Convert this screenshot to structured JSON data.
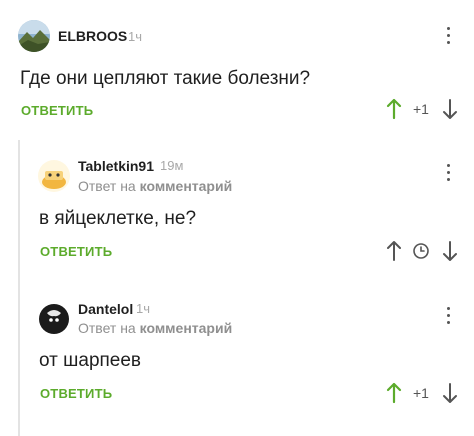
{
  "comments": [
    {
      "username": "ELBROOS",
      "time": "1ч",
      "text": "Где они цепляют такие болезни?",
      "reply_label": "ОТВЕТИТЬ",
      "rating": "+1",
      "avatar_icon": "mountain-landscape-avatar"
    },
    {
      "username": "Tabletkin91",
      "time": "19м",
      "reply_to_prefix": "Ответ на",
      "reply_to_target": "комментарий",
      "text": "в яйцеклетке, не?",
      "reply_label": "ОТВЕТИТЬ",
      "rating_icon": "clock-icon",
      "avatar_icon": "cartoon-avatar"
    },
    {
      "username": "Dantelol",
      "time": "1ч",
      "reply_to_prefix": "Ответ на",
      "reply_to_target": "комментарий",
      "text": "от шарпеев",
      "reply_label": "ОТВЕТИТЬ",
      "rating": "+1",
      "avatar_icon": "dark-figure-avatar"
    }
  ],
  "colors": {
    "accent_green": "#5cab2c",
    "vote_up_active": "#5cab2c",
    "text": "#1f1f1f",
    "muted": "#8f8f8f"
  }
}
